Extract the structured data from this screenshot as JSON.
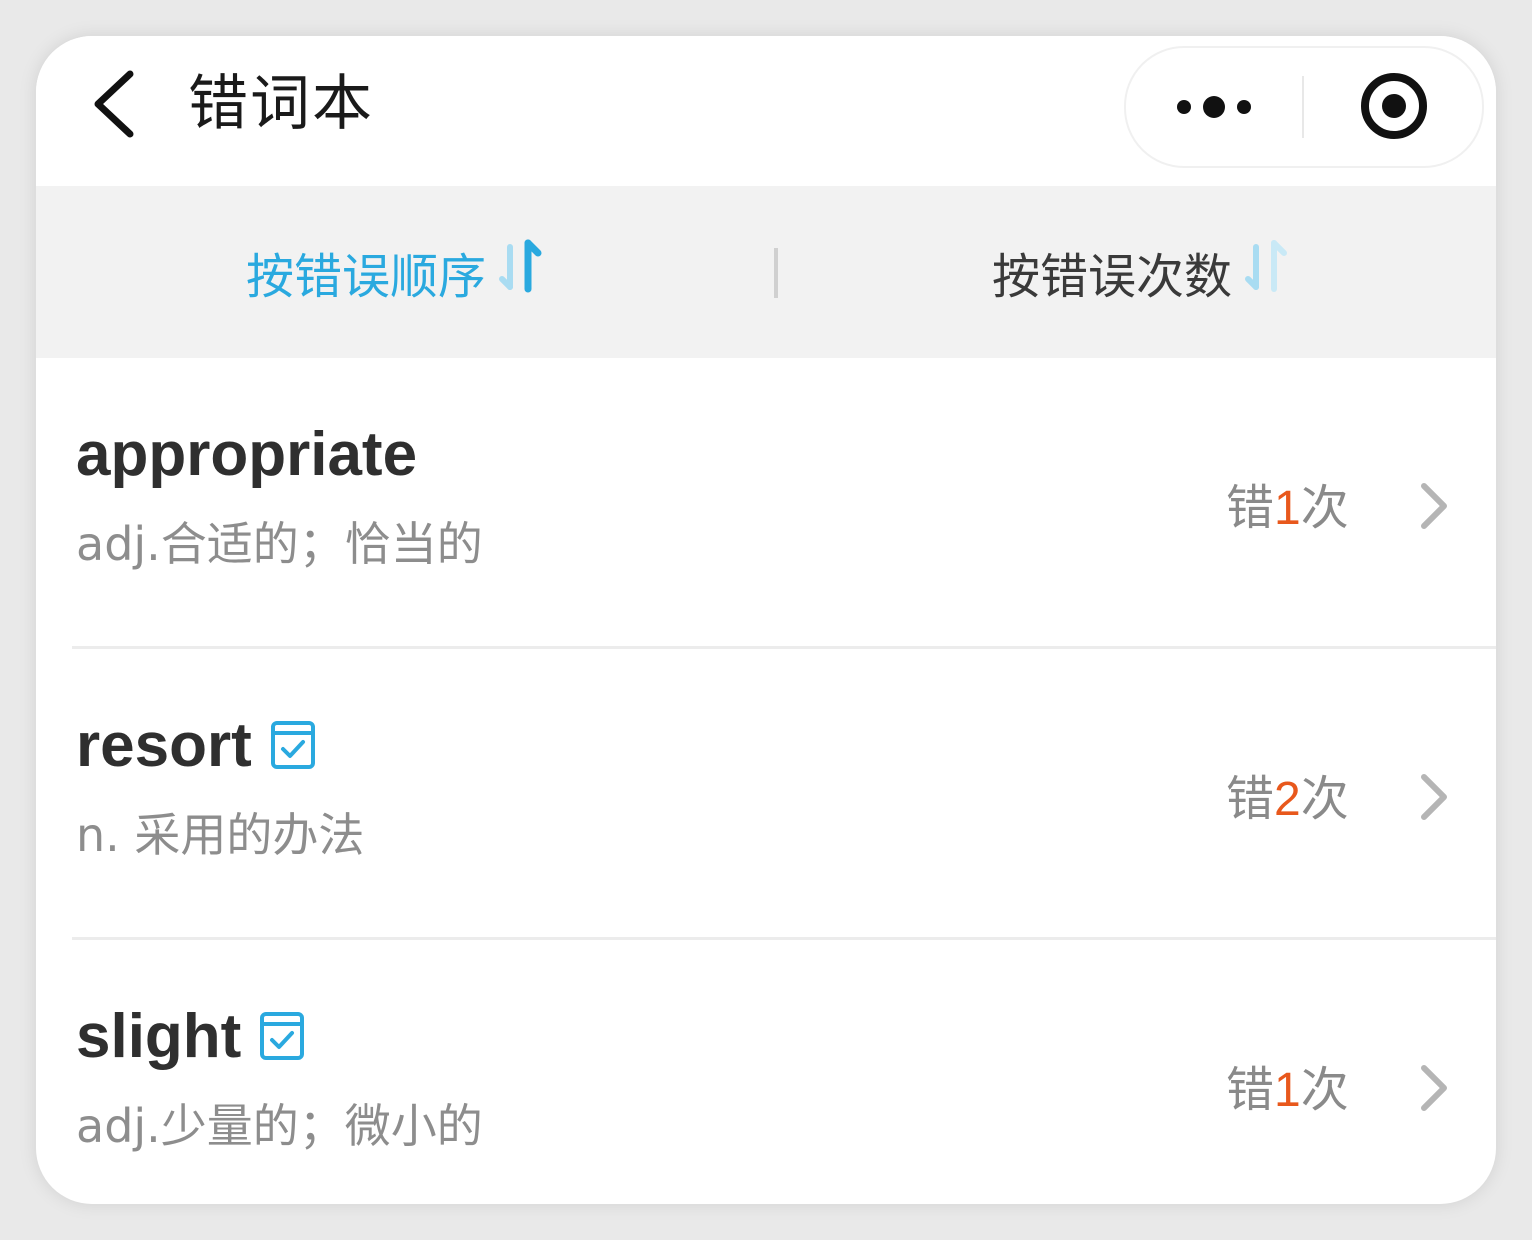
{
  "header": {
    "title": "错词本",
    "back_icon": "chevron-left-icon",
    "more_icon": "more-dots-icon",
    "close_icon": "target-circle-icon"
  },
  "sort_bar": {
    "options": [
      {
        "label": "按错误顺序",
        "active": true,
        "icon": "sort-arrows-icon"
      },
      {
        "label": "按错误次数",
        "active": false,
        "icon": "sort-arrows-icon"
      }
    ]
  },
  "colors": {
    "accent": "#2aa9df",
    "count_highlight": "#e8581c",
    "text_primary": "#2f2f2f",
    "text_secondary": "#8d8d8d"
  },
  "words": [
    {
      "word": "appropriate",
      "meaning": "adj.合适的；恰当的",
      "wrong_prefix": "错",
      "count": "1",
      "wrong_suffix": "次",
      "marked": false
    },
    {
      "word": "resort",
      "meaning": "n. 采用的办法",
      "wrong_prefix": "错",
      "count": "2",
      "wrong_suffix": "次",
      "marked": true
    },
    {
      "word": "slight",
      "meaning": "adj.少量的；微小的",
      "wrong_prefix": "错",
      "count": "1",
      "wrong_suffix": "次",
      "marked": true
    }
  ]
}
